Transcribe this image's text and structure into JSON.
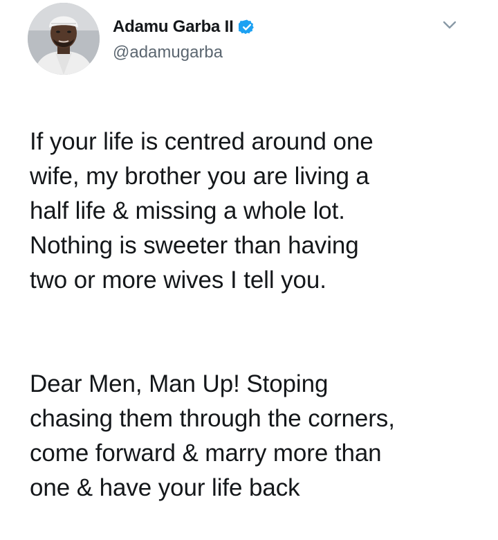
{
  "tweet": {
    "author": {
      "display_name": "Adamu Garba II",
      "handle": "@adamugarba",
      "verified": true,
      "avatar_icon": "profile-photo",
      "verified_icon": "verified-badge-icon"
    },
    "menu_icon": "chevron-down-icon",
    "paragraphs": [
      "If your life is centred around one\nwife, my brother you are living a\nhalf life & missing a whole lot.\nNothing is sweeter than having\ntwo or more wives I tell you.",
      "Dear Men, Man Up! Stoping\nchasing them through the corners,\ncome forward & marry more than\none & have your life back"
    ]
  },
  "colors": {
    "text": "#14171a",
    "secondary_text": "#5b6670",
    "verified_blue": "#1da1f2",
    "background": "#ffffff"
  }
}
